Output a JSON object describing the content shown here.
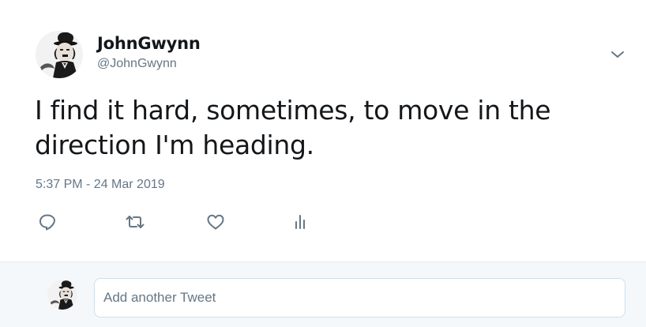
{
  "tweet": {
    "author": {
      "display_name": "JohnGwynn",
      "handle": "@JohnGwynn",
      "avatar_icon": "chaplin-avatar"
    },
    "text": "I find it hard, sometimes, to move in the direction I'm heading.",
    "timestamp": "5:37 PM - 24 Mar 2019",
    "actions": [
      {
        "name": "reply",
        "icon": "reply-icon"
      },
      {
        "name": "retweet",
        "icon": "retweet-icon"
      },
      {
        "name": "like",
        "icon": "heart-icon"
      },
      {
        "name": "analytics",
        "icon": "analytics-icon"
      }
    ],
    "menu_icon": "chevron-down-icon"
  },
  "reply_bar": {
    "placeholder": "Add another Tweet",
    "avatar_icon": "chaplin-avatar"
  },
  "colors": {
    "text_primary": "#14171a",
    "text_secondary": "#657786",
    "reply_background": "#f5f8fa",
    "input_border": "#c8e0f4"
  }
}
